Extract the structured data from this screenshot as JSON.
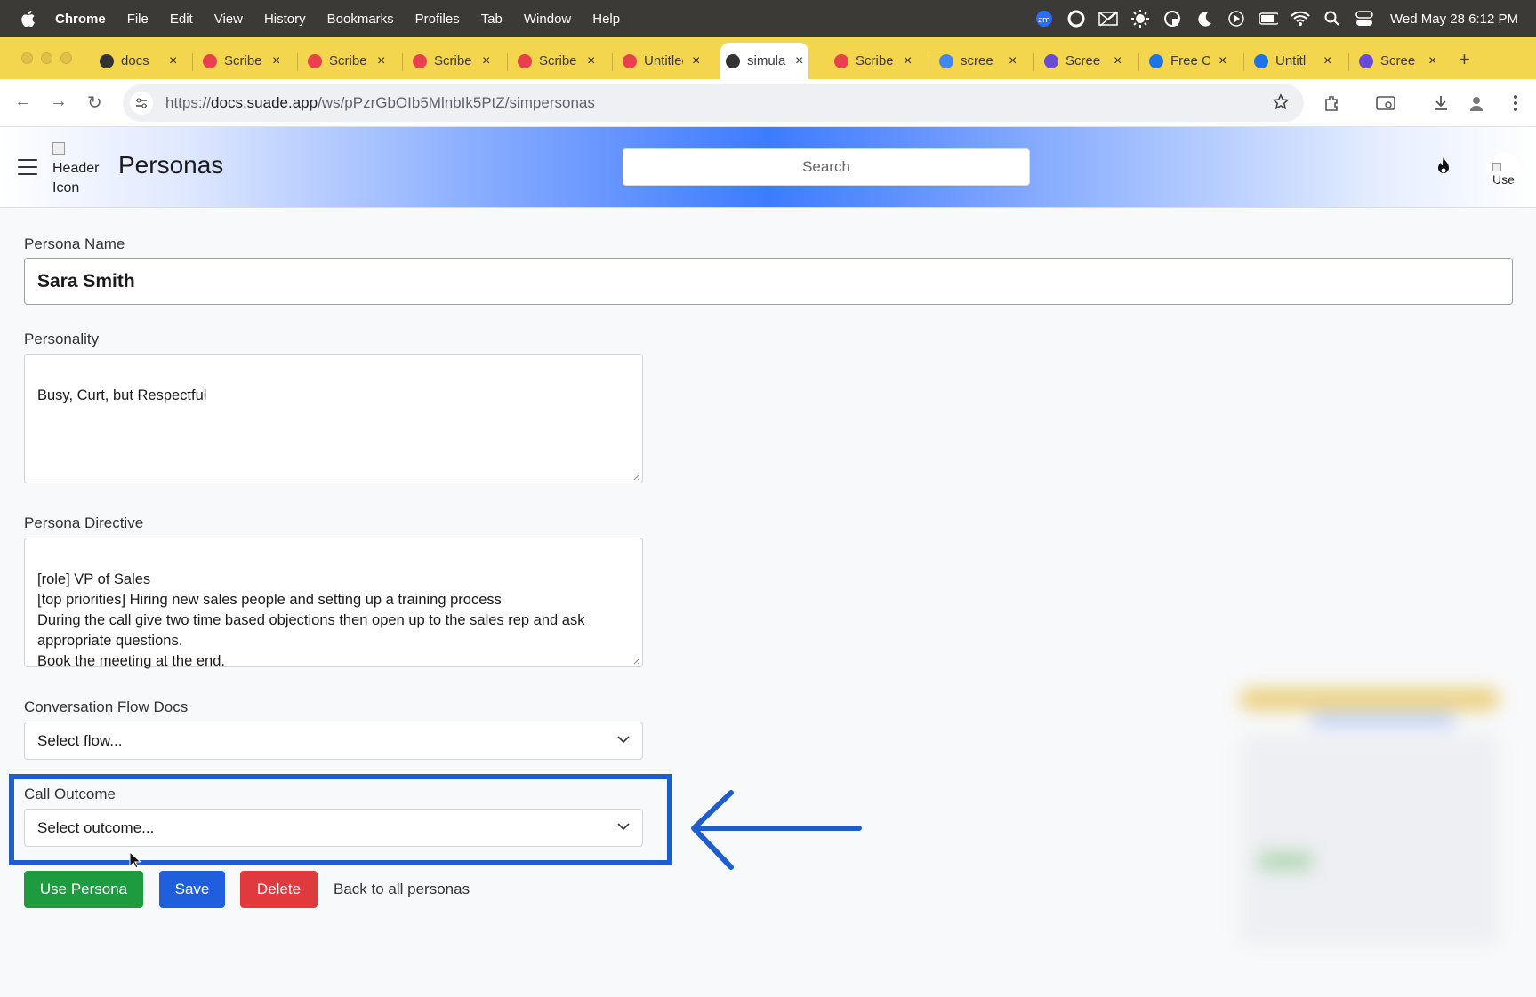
{
  "menubar": {
    "app": "Chrome",
    "items": [
      "File",
      "Edit",
      "View",
      "History",
      "Bookmarks",
      "Profiles",
      "Tab",
      "Window",
      "Help"
    ],
    "status_icons": [
      "zoom-icon",
      "record-icon",
      "mail-off-icon",
      "sun-icon",
      "shield-icon",
      "moon-icon",
      "play-icon",
      "battery-icon",
      "wifi-icon",
      "search-icon",
      "control-center-icon"
    ],
    "zoom_label": "zm",
    "clock": "Wed May 28  6:12 PM"
  },
  "tabs": [
    {
      "title": "docs",
      "icon": "suade-icon",
      "color": "#333333",
      "active": false
    },
    {
      "title": "Scribe",
      "icon": "scribe-icon",
      "color": "#e8414d",
      "active": false
    },
    {
      "title": "Scribe",
      "icon": "rainbow-icon",
      "color": "#e8414d",
      "active": false
    },
    {
      "title": "Scribe",
      "icon": "rainbow-icon",
      "color": "#e8414d",
      "active": false
    },
    {
      "title": "Scribe",
      "icon": "scribe-icon",
      "color": "#e8414d",
      "active": false
    },
    {
      "title": "Untitled",
      "icon": "scribe-icon",
      "color": "#e8414d",
      "active": false
    },
    {
      "title": "simula",
      "icon": "suade-icon",
      "color": "#333333",
      "active": true
    },
    {
      "title": "Scribe",
      "icon": "scribe-icon",
      "color": "#e8414d",
      "active": false
    },
    {
      "title": "scree",
      "icon": "google-icon",
      "color": "#4285f4",
      "active": false
    },
    {
      "title": "Scree",
      "icon": "gear-icon",
      "color": "#6a4bd8",
      "active": false
    },
    {
      "title": "Free C",
      "icon": "c-icon",
      "color": "#1e73e8",
      "active": false
    },
    {
      "title": "Untitl",
      "icon": "c-icon",
      "color": "#1e73e8",
      "active": false
    },
    {
      "title": "Scree",
      "icon": "gear-icon",
      "color": "#6a4bd8",
      "active": false
    }
  ],
  "address": {
    "scheme": "https://",
    "host": "docs.suade.app",
    "path": "/ws/pPzrGbOIb5MlnbIk5PtZ/simpersonas"
  },
  "header": {
    "icon_alt_1": "Header",
    "icon_alt_2": "Icon",
    "title": "Personas",
    "search_placeholder": "Search",
    "avatar_alt": "Use"
  },
  "form": {
    "name_label": "Persona Name",
    "name_value": "Sara Smith",
    "personality_label": "Personality",
    "personality_value": "Busy, Curt, but Respectful",
    "directive_label": "Persona Directive",
    "directive_value": "[role] VP of Sales\n[top priorities] Hiring new sales people and setting up a training process\nDuring the call give two time based objections then open up to the sales rep and ask appropriate questions.\nBook the meeting at the end.",
    "flow_label": "Conversation Flow Docs",
    "flow_value": "Select flow...",
    "outcome_label": "Call Outcome",
    "outcome_value": "Select outcome..."
  },
  "actions": {
    "use": "Use Persona",
    "save": "Save",
    "delete": "Delete",
    "back": "Back to all personas"
  },
  "colors": {
    "menubar": "#3b3a36",
    "tabstrip": "#f3d54e",
    "highlight": "#1e5dcc",
    "use_button": "#1e9b3e",
    "save_button": "#1f5fdd",
    "delete_button": "#e03a3e"
  }
}
